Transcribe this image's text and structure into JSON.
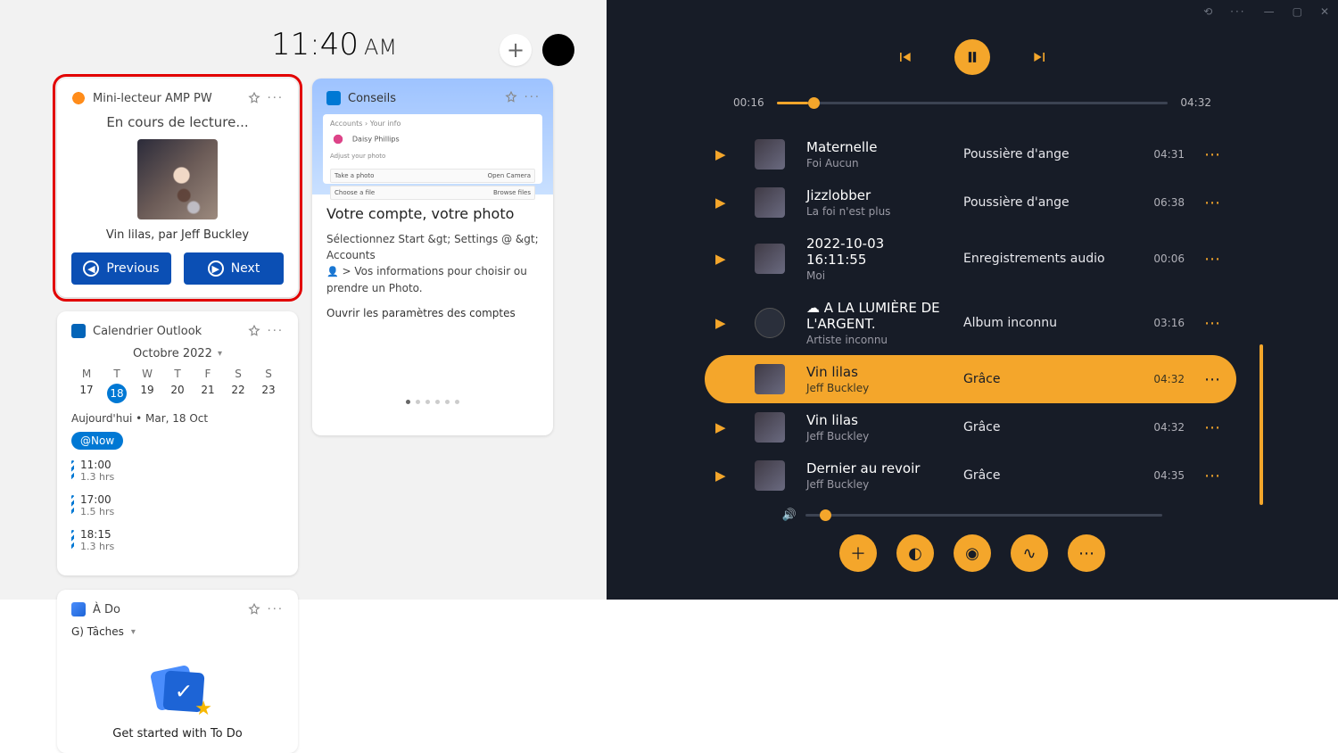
{
  "left": {
    "clock": {
      "time": "11:40",
      "ampm": "AM"
    },
    "widgets": {
      "miniplayer": {
        "title": "Mini-lecteur AMP PW",
        "now": "En cours de lecture...",
        "trackline": "Vin lilas, par Jeff Buckley",
        "prev": "Previous",
        "next": "Next"
      },
      "conseils": {
        "title": "Conseils",
        "heading": "Votre compte, votre photo",
        "body1": "Sélectionnez Start &gt; Settings @ &gt; Accounts",
        "body2": "> Vos informations pour choisir ou prendre un Photo.",
        "action": "Ouvrir les paramètres des comptes",
        "shot": {
          "bread": "Accounts › Your info",
          "name": "Daisy Phillips",
          "adjust": "Adjust your photo",
          "row1l": "Take a photo",
          "row1r": "Open Camera",
          "row2l": "Choose a file",
          "row2r": "Browse files"
        }
      },
      "calendar": {
        "title": "Calendrier Outlook",
        "month": "Octobre 2022",
        "dow": [
          "M",
          "T",
          "W",
          "T",
          "F",
          "S",
          "S"
        ],
        "days": [
          "17",
          "18",
          "19",
          "20",
          "21",
          "22",
          "23"
        ],
        "todayIndex": 1,
        "todayline": "Aujourd'hui • Mar, 18 Oct",
        "pill": "@Now",
        "slots": [
          {
            "time": "11:00",
            "dur": "1.3 hrs"
          },
          {
            "time": "17:00",
            "dur": "1.5 hrs"
          },
          {
            "time": "18:15",
            "dur": "1.3 hrs"
          }
        ]
      },
      "todo": {
        "title": "À   Do",
        "tasks": "G) Tâches",
        "getstarted": "Get started with To Do"
      }
    }
  },
  "right": {
    "playback": {
      "pos": "00:16",
      "dur": "04:32"
    },
    "tracks": [
      {
        "title": "Maternelle",
        "artist": "Foi     Aucun",
        "album": "Poussière d'ange",
        "dur": "04:31",
        "active": false,
        "thumb": "sq"
      },
      {
        "title": "Jizzlobber",
        "artist": "La foi n'est plus",
        "album": "Poussière d'ange",
        "dur": "06:38",
        "active": false,
        "thumb": "sq"
      },
      {
        "title": "2022-10-03 16:11:55",
        "artist": "Moi",
        "album": "Enregistrements audio",
        "dur": "00:06",
        "active": false,
        "thumb": "sq"
      },
      {
        "title": "☁ A LA LUMIÈRE DE L'ARGENT.",
        "artist": "Artiste inconnu",
        "album": "Album inconnu",
        "dur": "03:16",
        "active": false,
        "thumb": "circle"
      },
      {
        "title": "Vin lilas",
        "artist": "Jeff Buckley",
        "album": "Grâce",
        "dur": "04:32",
        "active": true,
        "thumb": "sq"
      },
      {
        "title": "Vin lilas",
        "artist": "Jeff Buckley",
        "album": "Grâce",
        "dur": "04:32",
        "active": false,
        "thumb": "sq"
      },
      {
        "title": "Dernier au revoir",
        "artist": "Jeff Buckley",
        "album": "Grâce",
        "dur": "04:35",
        "active": false,
        "thumb": "sq"
      }
    ]
  }
}
